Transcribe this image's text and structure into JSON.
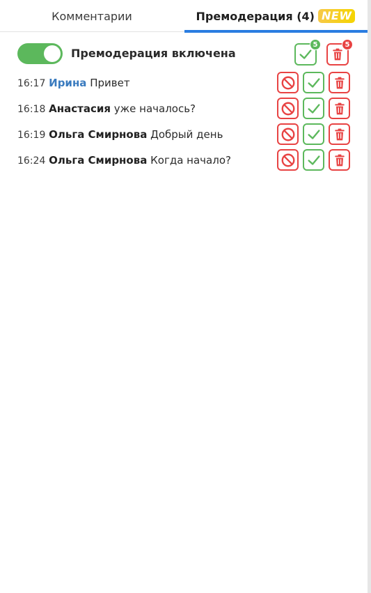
{
  "tabs": {
    "comments_label": "Комментарии",
    "premod_label": "Премодерация (4)",
    "new_badge": "NEW"
  },
  "premod": {
    "toggle_label": "Премодерация включена",
    "toggle_on": true,
    "approve_all_count": "5",
    "delete_all_count": "5"
  },
  "messages": [
    {
      "time": "16:17",
      "author": "Ирина",
      "text": "Привет"
    },
    {
      "time": "16:18",
      "author": "Анастасия",
      "text": "уже началось?"
    },
    {
      "time": "16:19",
      "author": "Ольга Смирнова",
      "text": "Добрый день"
    },
    {
      "time": "16:24",
      "author": "Ольга Смирнова",
      "text": "Когда начало?"
    }
  ],
  "icons": {
    "approve": "check-icon",
    "delete": "trash-icon",
    "block": "block-icon"
  },
  "colors": {
    "accent_blue": "#2a7de1",
    "green": "#5cb85c",
    "red": "#e84343",
    "badge_yellow": "#f5d400",
    "author_highlight": "#3a7bbf"
  }
}
